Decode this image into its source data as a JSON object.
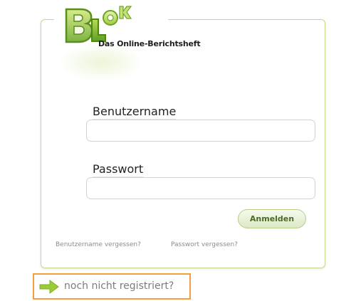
{
  "brand": {
    "tagline": "Das Online-Berichtsheft",
    "colors": {
      "green": "#8bc34a",
      "dark_green": "#5a9a1a",
      "accent_orange": "#f59e3c"
    }
  },
  "form": {
    "username_label": "Benutzername",
    "username_value": "",
    "password_label": "Passwort",
    "password_value": "",
    "submit_label": "Anmelden"
  },
  "links": {
    "forgot_username": "Benutzername vergessen?",
    "forgot_password": "Passwort vergessen?",
    "register": "noch nicht registriert?"
  },
  "icons": {
    "logo": "blok-logo",
    "register_arrow": "arrow-right-icon"
  }
}
